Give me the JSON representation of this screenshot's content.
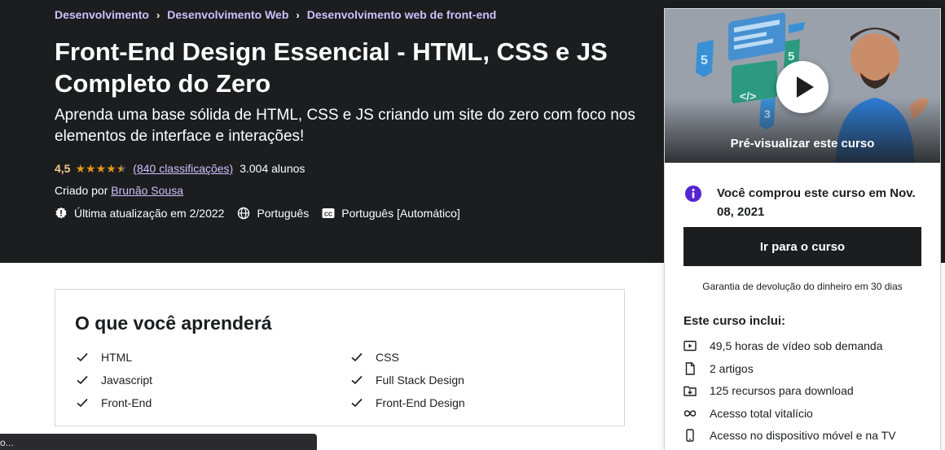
{
  "breadcrumb": [
    "Desenvolvimento",
    "Desenvolvimento Web",
    "Desenvolvimento web de front-end"
  ],
  "breadcrumb_separator": "›",
  "course": {
    "title": "Front-End Design Essencial - HTML, CSS e JS Completo do Zero",
    "subtitle": "Aprenda uma base sólida de HTML, CSS e JS criando um site do zero com foco nos elementos de interface e interações!",
    "rating": "4,5",
    "stars": 4.5,
    "ratings_count": "(840 classificações)",
    "students": "3.004 alunos",
    "created_by_label": "Criado por",
    "instructor": "Brunão Sousa",
    "last_updated": "Última atualização em 2/2022",
    "language": "Português",
    "captions": "Português [Automático]"
  },
  "learn": {
    "title": "O que você aprenderá",
    "items": [
      "HTML",
      "CSS",
      "Javascript",
      "Full Stack Design",
      "Front-End",
      "Front-End Design"
    ]
  },
  "sidebar": {
    "preview_label": "Pré-visualizar este curso",
    "purchased_text": "Você comprou este curso em Nov. 08, 2021",
    "cta_label": "Ir para o curso",
    "guarantee": "Garantia de devolução do dinheiro em 30 dias",
    "includes_title": "Este curso inclui:",
    "includes": [
      {
        "icon": "video-icon",
        "label": "49,5 horas de vídeo sob demanda"
      },
      {
        "icon": "file-icon",
        "label": "2 artigos"
      },
      {
        "icon": "download-icon",
        "label": "125 recursos para download"
      },
      {
        "icon": "infinity-icon",
        "label": "Acesso total vitalício"
      },
      {
        "icon": "mobile-icon",
        "label": "Acesso no dispositivo móvel e na TV"
      }
    ]
  },
  "status_bar": "o...",
  "colors": {
    "hero_bg": "#1c1d1f",
    "breadcrumb": "#cec0fc",
    "rating": "#f3ca8c",
    "star": "#e59819",
    "info_icon": "#5624d0"
  }
}
